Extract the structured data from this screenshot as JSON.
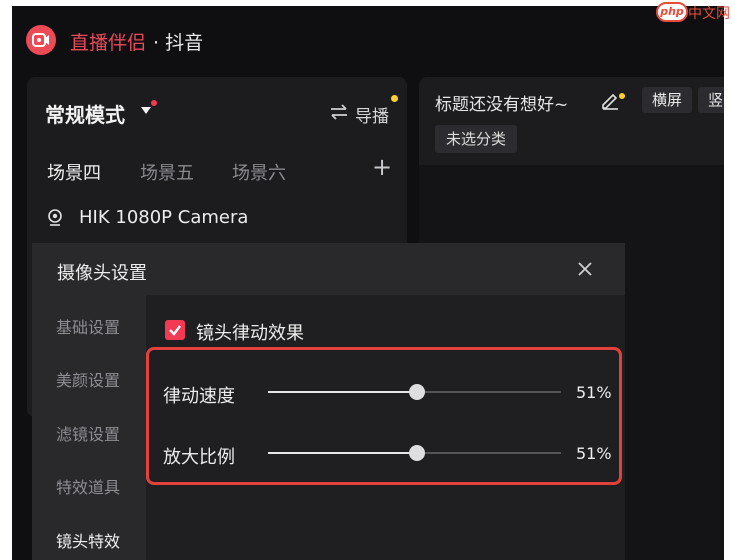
{
  "titlebar": {
    "app_name": "直播伴侣",
    "app_sub": "· 抖音"
  },
  "mode": {
    "label": "常规模式",
    "director_label": "导播"
  },
  "scenes": [
    {
      "label": "场景四",
      "active": true
    },
    {
      "label": "场景五",
      "active": false
    },
    {
      "label": "场景六",
      "active": false
    }
  ],
  "scene_add_label": "+",
  "camera": {
    "name": "HIK 1080P Camera"
  },
  "stream": {
    "title": "标题还没有想好~",
    "landscape_label": "横屏",
    "portrait_label": "竖",
    "category": "未选分类"
  },
  "dialog": {
    "title": "摄像头设置",
    "close_label": "✕",
    "nav": [
      {
        "label": "基础设置",
        "active": false
      },
      {
        "label": "美颜设置",
        "active": false
      },
      {
        "label": "滤镜设置",
        "active": false
      },
      {
        "label": "特效道具",
        "active": false
      },
      {
        "label": "镜头特效",
        "active": true
      }
    ],
    "checkbox": {
      "label": "镜头律动效果",
      "checked": true
    },
    "sliders": [
      {
        "label": "律动速度",
        "value": 51,
        "display": "51%"
      },
      {
        "label": "放大比例",
        "value": 51,
        "display": "51%"
      }
    ]
  },
  "watermark": {
    "badge": "php",
    "text": "中文网"
  },
  "colors": {
    "accent": "#f23a55",
    "highlight": "#e2413c",
    "notify_dot": "#ffcf2e"
  }
}
